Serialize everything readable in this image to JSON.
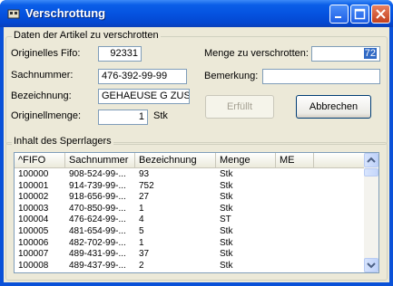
{
  "window": {
    "title": "Verschrottung",
    "titlebar_color": "#0a51d8"
  },
  "article_group": {
    "label": "Daten der Artikel zu verschrotten",
    "orig_fifo_label": "Originelles Fifo:",
    "orig_fifo_value": "92331",
    "sachnummer_label": "Sachnummer:",
    "sachnummer_value": "476-392-99-99",
    "bezeichnung_label": "Bezeichnung:",
    "bezeichnung_value": "GEHAEUSE G ZUS",
    "originalmenge_label": "Originellmenge:",
    "originalmenge_value": "1",
    "originalmenge_unit": "Stk",
    "menge_label": "Menge zu verschrotten:",
    "menge_value": "72",
    "bemerkung_label": "Bemerkung:",
    "bemerkung_value": "",
    "erfuellt_button": "Erfüllt",
    "abbrechen_button": "Abbrechen"
  },
  "sperrlager": {
    "label": "Inhalt des Sperrlagers",
    "columns": [
      "^FIFO",
      "Sachnummer",
      "Bezeichnung",
      "Menge",
      "ME"
    ],
    "rows": [
      [
        "100000",
        "908-524-99-...",
        "93",
        "Stk"
      ],
      [
        "100001",
        "914-739-99-...",
        "752",
        "Stk"
      ],
      [
        "100002",
        "918-656-99-...",
        "27",
        "Stk"
      ],
      [
        "100003",
        "470-850-99-...",
        "1",
        "Stk"
      ],
      [
        "100004",
        "476-624-99-...",
        "4",
        "ST"
      ],
      [
        "100005",
        "481-654-99-...",
        "5",
        "Stk"
      ],
      [
        "100006",
        "482-702-99-...",
        "1",
        "Stk"
      ],
      [
        "100007",
        "489-431-99-...",
        "37",
        "Stk"
      ],
      [
        "100008",
        "489-437-99-...",
        "2",
        "Stk"
      ]
    ]
  }
}
